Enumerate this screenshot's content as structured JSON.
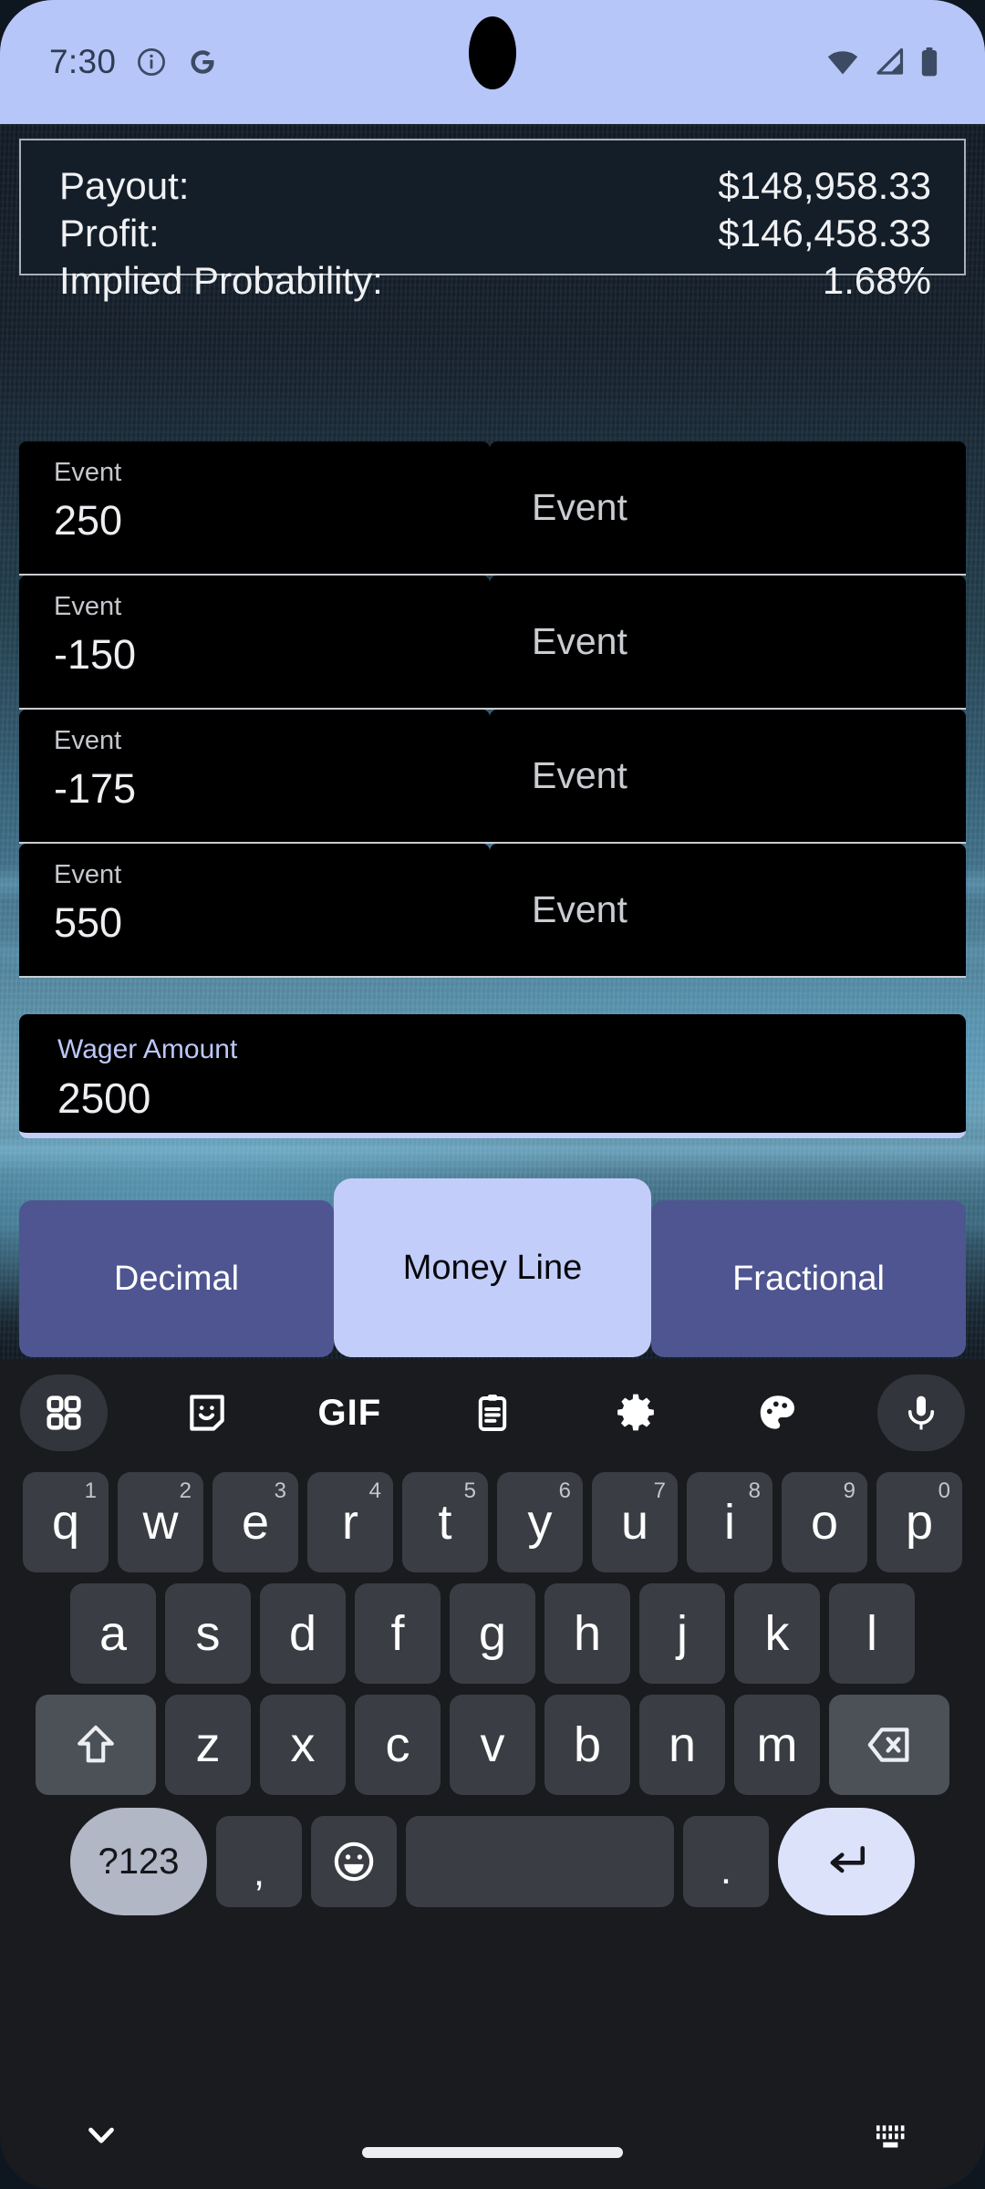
{
  "statusbar": {
    "time": "7:30",
    "icons_left": [
      "info-icon",
      "google-icon"
    ],
    "icons_right": [
      "wifi-icon",
      "cellular-signal-icon",
      "battery-icon"
    ],
    "bg_color": "#b6c6f8"
  },
  "summary": {
    "rows": [
      {
        "label": "Payout:",
        "value": "$148,958.33"
      },
      {
        "label": "Profit:",
        "value": "$146,458.33"
      },
      {
        "label": "Implied Probability:",
        "value": "1.68%"
      }
    ]
  },
  "events": [
    {
      "label": "Event",
      "value": "250",
      "name_placeholder": "Event"
    },
    {
      "label": "Event",
      "value": "-150",
      "name_placeholder": "Event"
    },
    {
      "label": "Event",
      "value": "-175",
      "name_placeholder": "Event"
    },
    {
      "label": "Event",
      "value": "550",
      "name_placeholder": "Event"
    }
  ],
  "wager": {
    "label": "Wager Amount",
    "value": "2500",
    "accent_color": "#c3cdf9"
  },
  "odds_format": {
    "options": [
      {
        "label": "Decimal",
        "selected": false
      },
      {
        "label": "Money Line",
        "selected": true
      },
      {
        "label": "Fractional",
        "selected": false
      }
    ],
    "selected_color": "#c3cdf9",
    "unselected_color": "#4e5590"
  },
  "keyboard": {
    "toolbar": [
      "apps-grid-icon",
      "sticker-icon",
      "gif-icon",
      "clipboard-icon",
      "settings-gear-icon",
      "palette-icon",
      "microphone-icon"
    ],
    "gif_label": "GIF",
    "row1": [
      {
        "key": "q",
        "num": "1"
      },
      {
        "key": "w",
        "num": "2"
      },
      {
        "key": "e",
        "num": "3"
      },
      {
        "key": "r",
        "num": "4"
      },
      {
        "key": "t",
        "num": "5"
      },
      {
        "key": "y",
        "num": "6"
      },
      {
        "key": "u",
        "num": "7"
      },
      {
        "key": "i",
        "num": "8"
      },
      {
        "key": "o",
        "num": "9"
      },
      {
        "key": "p",
        "num": "0"
      }
    ],
    "row2": [
      "a",
      "s",
      "d",
      "f",
      "g",
      "h",
      "j",
      "k",
      "l"
    ],
    "row3": [
      "z",
      "x",
      "c",
      "v",
      "b",
      "n",
      "m"
    ],
    "shift_icon": "shift-arrow-up-icon",
    "backspace_icon": "backspace-icon",
    "symbols_label": "?123",
    "comma_label": ",",
    "emoji_icon": "emoji-smiley-icon",
    "space_label": "",
    "period_label": ".",
    "enter_icon": "enter-return-icon"
  },
  "navbar": {
    "back_icon": "chevron-down-icon",
    "home_indicator": "home-pill",
    "keyboard_switch_icon": "keyboard-switch-icon"
  }
}
